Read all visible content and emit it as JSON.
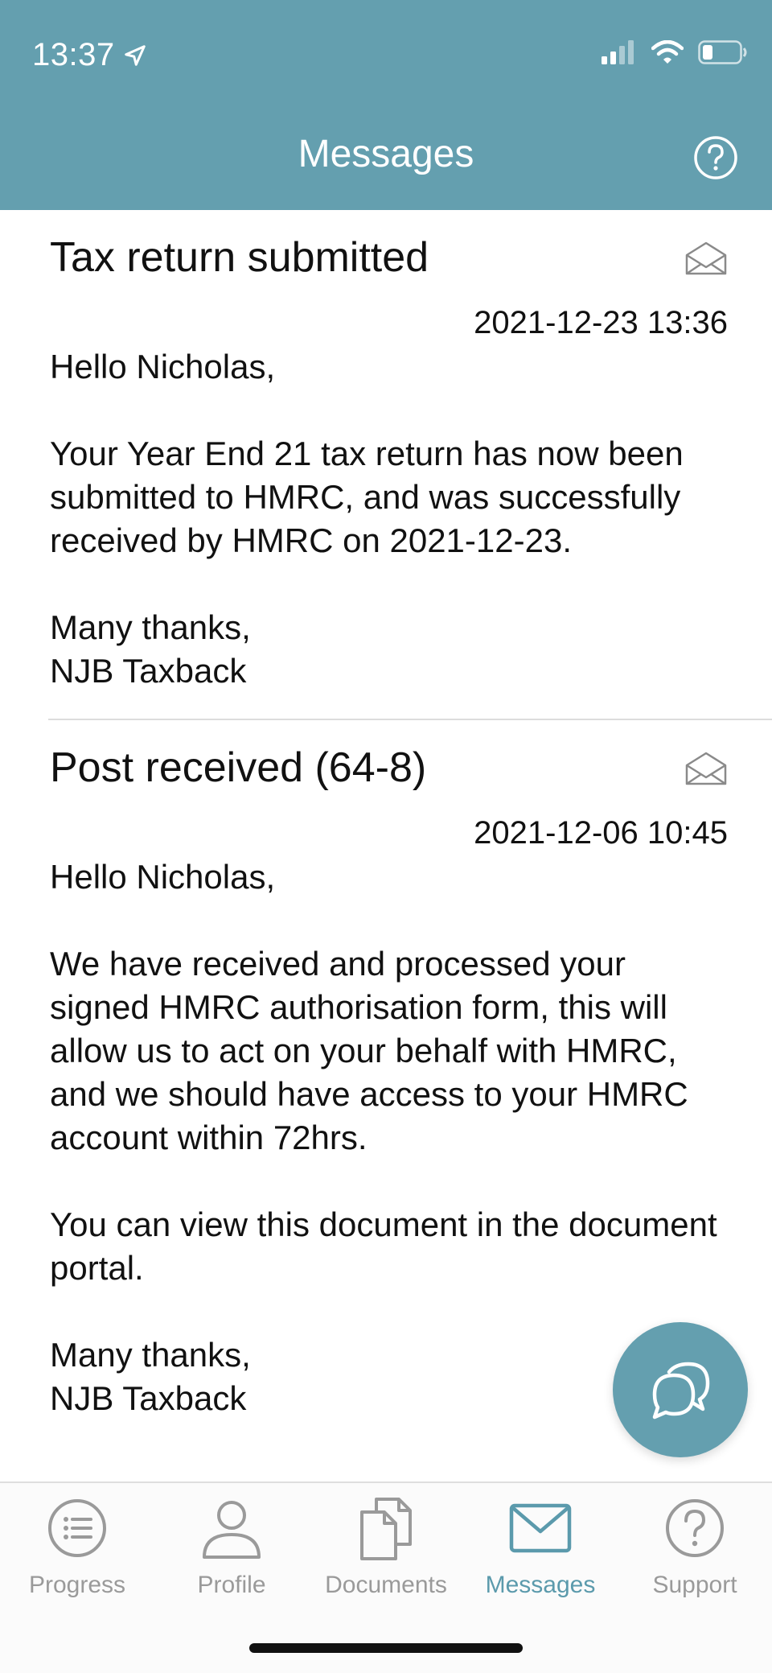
{
  "status_bar": {
    "time": "13:37"
  },
  "header": {
    "title": "Messages"
  },
  "messages": [
    {
      "title": "Tax return submitted",
      "date": "2021-12-23 13:36",
      "body": "Hello Nicholas,\n\nYour Year End 21 tax return has now been submitted to HMRC, and was successfully received by HMRC on 2021-12-23.\n\nMany thanks,\nNJB Taxback"
    },
    {
      "title": "Post received (64-8)",
      "date": "2021-12-06 10:45",
      "body": "Hello Nicholas,\n\nWe have received and processed your signed HMRC authorisation form, this will allow us to act on your behalf with HMRC, and we should have access to your HMRC account within 72hrs.\n\nYou can view this document in the document portal.\n\nMany thanks,\nNJB Taxback"
    }
  ],
  "tabbar": {
    "tabs": [
      {
        "label": "Progress",
        "icon": "list-icon"
      },
      {
        "label": "Profile",
        "icon": "person-icon"
      },
      {
        "label": "Documents",
        "icon": "documents-icon"
      },
      {
        "label": "Messages",
        "icon": "envelope-icon",
        "active": true
      },
      {
        "label": "Support",
        "icon": "help-icon"
      }
    ]
  },
  "colors": {
    "accent": "#649faf",
    "tab_inactive": "#9a9a9a",
    "tab_active": "#5b9aac"
  }
}
